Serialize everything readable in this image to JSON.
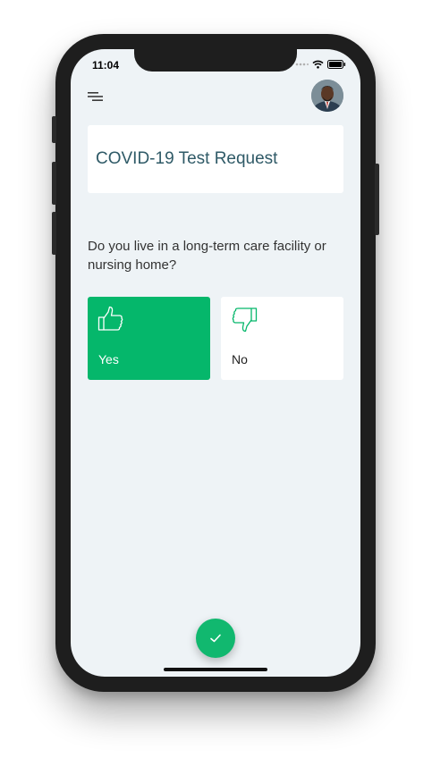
{
  "status_bar": {
    "time": "11:04"
  },
  "header": {
    "menu_icon": "menu-icon",
    "avatar": "user-avatar"
  },
  "title_card": {
    "title": "COVID-19 Test Request"
  },
  "question": {
    "text": "Do you live in a long-term care facility or nursing home?"
  },
  "options": [
    {
      "label": "Yes",
      "icon": "thumbs-up-icon",
      "selected": true
    },
    {
      "label": "No",
      "icon": "thumbs-down-icon",
      "selected": false
    }
  ],
  "confirm": {
    "icon": "check-icon"
  },
  "colors": {
    "accent": "#05b76b",
    "title": "#2f5a67",
    "background": "#eef3f6"
  }
}
